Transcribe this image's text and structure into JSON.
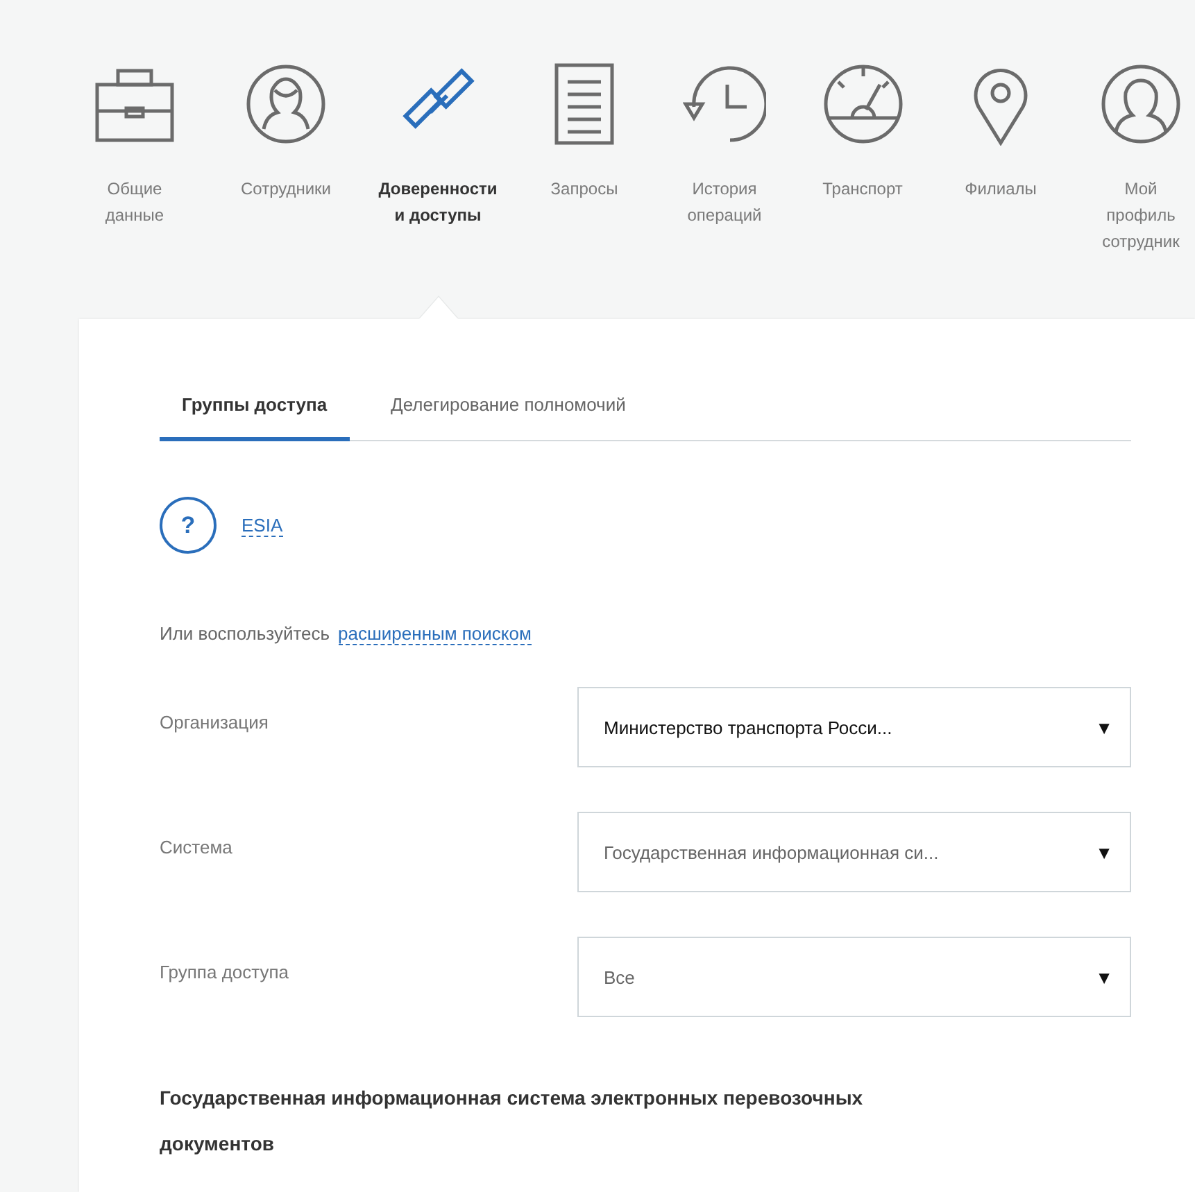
{
  "nav": [
    {
      "label": "Общие\nданные",
      "selected": false
    },
    {
      "label": "Сотрудники",
      "selected": false
    },
    {
      "label": "Доверенности\nи доступы",
      "selected": true
    },
    {
      "label": "Запросы",
      "selected": false
    },
    {
      "label": "История\nопераций",
      "selected": false
    },
    {
      "label": "Транспорт",
      "selected": false
    },
    {
      "label": "Филиалы",
      "selected": false
    },
    {
      "label": "Мой\nпрофиль\nсотрудник",
      "selected": false
    }
  ],
  "tabs": [
    {
      "label": "Группы доступа",
      "selected": true
    },
    {
      "label": "Делегирование полномочий",
      "selected": false
    }
  ],
  "help": {
    "icon_text": "?",
    "link": "ESIA"
  },
  "search_hint": {
    "text": "Или воспользуйтесь",
    "link": "расширенным поиском"
  },
  "filters": [
    {
      "label": "Организация",
      "value": "Министерство транспорта Росси...",
      "highlighted": true,
      "arrow": "▼"
    },
    {
      "label": "Система",
      "value": "Государственная информационная си...",
      "highlighted": false,
      "arrow": "▼"
    },
    {
      "label": "Группа доступа",
      "value": "Все",
      "highlighted": false,
      "arrow": "▼"
    }
  ],
  "section_title": "Государственная информационная система электронных перевозочных документов"
}
